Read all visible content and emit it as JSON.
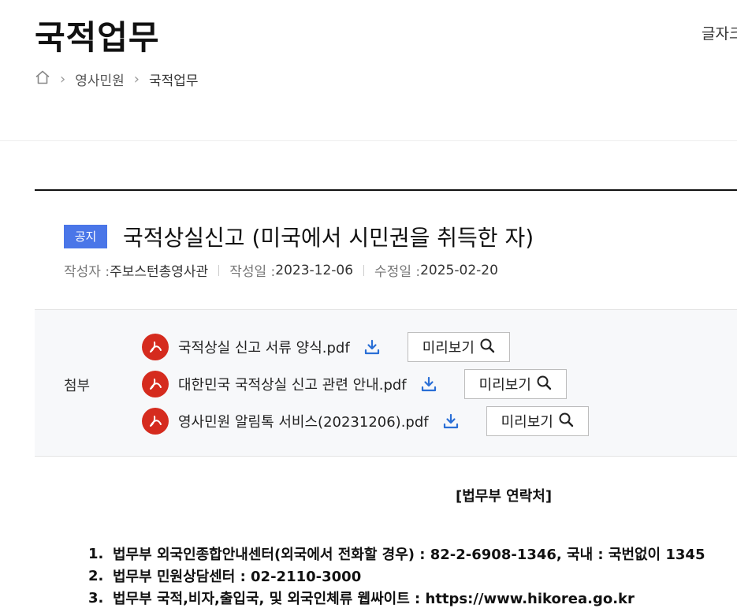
{
  "page": {
    "title": "국적업무",
    "font_size_label": "글자크기"
  },
  "breadcrumb": {
    "items": [
      "영사민원",
      "국적업무"
    ]
  },
  "post": {
    "badge": "공지",
    "title": "국적상실신고 (미국에서 시민권을 취득한 자)",
    "meta": {
      "author_label": "작성자 : ",
      "author": "주보스턴총영사관",
      "created_label": "작성일 : ",
      "created": "2023-12-06",
      "modified_label": "수정일 : ",
      "modified": "2025-02-20"
    }
  },
  "attachments": {
    "label": "첨부",
    "preview_label": "미리보기",
    "files": [
      {
        "name": "국적상실 신고 서류 양식.pdf"
      },
      {
        "name": "대한민국 국적상실 신고 관련 안내.pdf"
      },
      {
        "name": "영사민원 알림톡 서비스(20231206).pdf"
      }
    ]
  },
  "contacts": {
    "heading": "[법무부 연락처]",
    "items": [
      {
        "num": "1.",
        "text": "법무부 외국인종합안내센터(외국에서 전화할 경우) : 82-2-6908-1346, 국내 : 국번없이 1345"
      },
      {
        "num": "2.",
        "text": "법무부 민원상담센터 : 02-2110-3000"
      },
      {
        "num": "3.",
        "text": "법무부 국적,비자,출입국, 및 외국인체류 웹싸이트 : https://www.hikorea.go.kr"
      }
    ]
  },
  "colors": {
    "badge": "#4a76e8",
    "pdf_icon": "#d52b1e",
    "download_icon": "#2a6fd6"
  }
}
